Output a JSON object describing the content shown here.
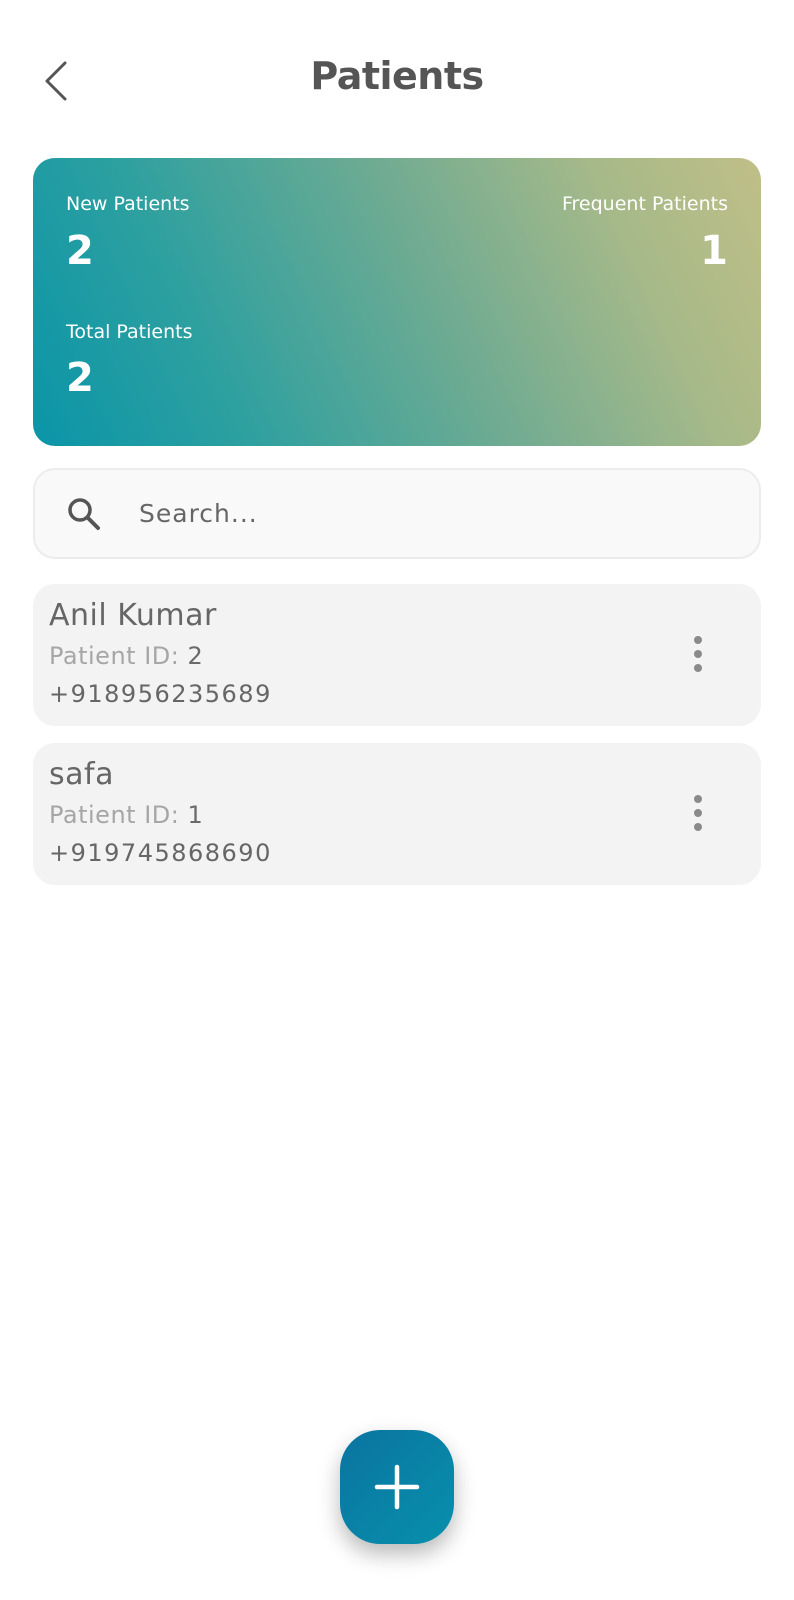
{
  "header": {
    "title": "Patients",
    "back_icon": "chevron-left-icon"
  },
  "stats": {
    "new_label": "New Patients",
    "new_value": "2",
    "frequent_label": "Frequent Patients",
    "frequent_value": "1",
    "total_label": "Total Patients",
    "total_value": "2",
    "gradient_colors": [
      "#0a95a8",
      "#6fab92",
      "#c0bf87"
    ]
  },
  "search": {
    "placeholder": "Search...",
    "value": "",
    "icon": "search-icon"
  },
  "patients": [
    {
      "name": "Anil Kumar",
      "id_label": "Patient ID: ",
      "id": "2",
      "phone": "+918956235689"
    },
    {
      "name": "safa",
      "id_label": "Patient ID: ",
      "id": "1",
      "phone": "+919745868690"
    }
  ],
  "fab": {
    "icon": "plus-icon",
    "color": "#0a80a6"
  }
}
